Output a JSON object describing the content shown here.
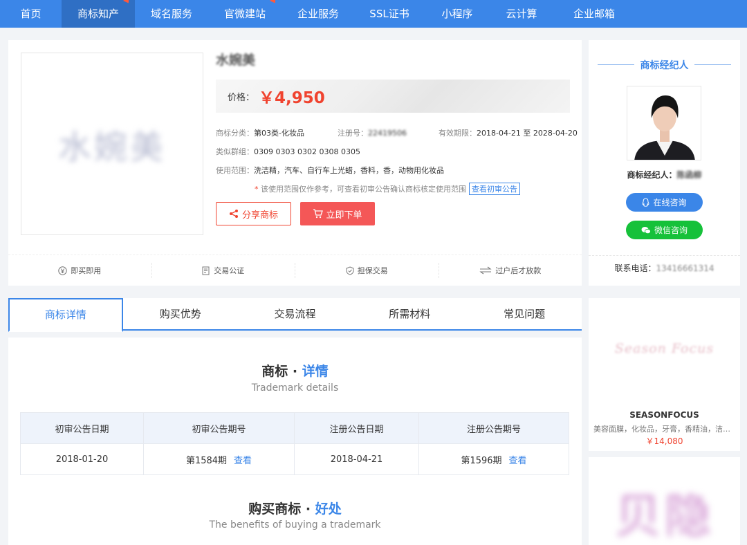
{
  "nav": {
    "items": [
      "首页",
      "商标知产",
      "域名服务",
      "官微建站",
      "企业服务",
      "SSL证书",
      "小程序",
      "云计算",
      "企业邮箱"
    ]
  },
  "trademark": {
    "image_text": "水婉美",
    "name": "水婉美",
    "price_label": "价格：",
    "price": "￥4,950",
    "category_label": "商标分类：",
    "category": "第03类-化妆品",
    "reg_no_label": "注册号：",
    "reg_no": "22419506",
    "validity_label": "有效期限：",
    "validity": "2018-04-21 至 2028-04-20",
    "group_label": "类似群组：",
    "group": "0309 0303 0302 0308 0305",
    "scope_label": "使用范围：",
    "scope": "洗洁精，汽车、自行车上光蜡，香料，香，动物用化妆品",
    "note": "该使用范围仅作参考，可查看初审公告确认商标核定使用范围",
    "note_link": "查看初审公告",
    "share_label": "分享商标",
    "order_label": "立即下单"
  },
  "features": [
    "即买即用",
    "交易公证",
    "担保交易",
    "过户后才放款"
  ],
  "agent": {
    "title": "商标经纪人",
    "name_label": "商标经纪人：",
    "name": "陈函柳",
    "online_label": "在线咨询",
    "wechat_label": "微信咨询",
    "phone_label": "联系电话：",
    "phone": "13416661314"
  },
  "tabs": [
    "商标详情",
    "购买优势",
    "交易流程",
    "所需材料",
    "常见问题"
  ],
  "details": {
    "title_main": "商标 · ",
    "title_hl": "详情",
    "subtitle": "Trademark details",
    "headers": [
      "初审公告日期",
      "初审公告期号",
      "注册公告日期",
      "注册公告期号"
    ],
    "row": {
      "pre_date": "2018-01-20",
      "pre_no": "第1584期",
      "reg_date": "2018-04-21",
      "reg_no": "第1596期",
      "view": "查看"
    },
    "benefit_main": "购买商标 · ",
    "benefit_hl": "好处",
    "benefit_sub": "The benefits of buying a trademark"
  },
  "side": {
    "p1_logo": "Season Focus",
    "p1_name": "SEASONFOCUS",
    "p1_desc": "美容面膜，化妆品，牙膏，香精油，洁肤...",
    "p1_price": "￥14,080",
    "p2_logo": "贝隐"
  },
  "colors": {
    "brand": "#3b86e8",
    "price": "#f0432f",
    "wechat": "#16c13a"
  }
}
